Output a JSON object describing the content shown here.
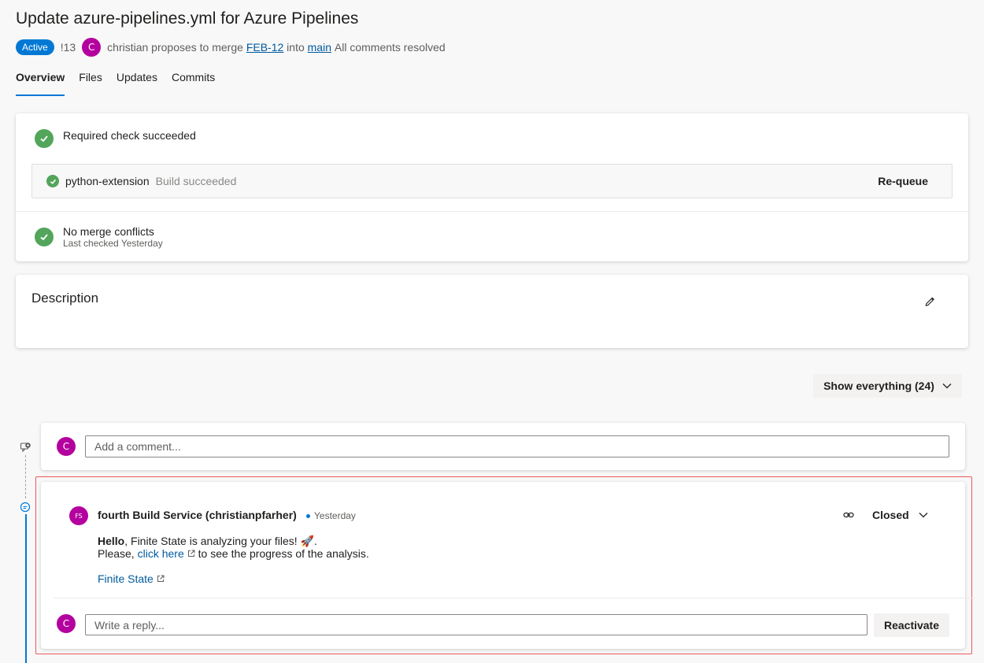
{
  "header": {
    "title": "Update azure-pipelines.yml for Azure Pipelines",
    "status_badge": "Active",
    "pr_id": "!13",
    "author_initial": "C",
    "proposal_text": "christian proposes to merge",
    "source_branch": "FEB-12",
    "into_text": "into",
    "target_branch": "main",
    "comments_status": "All comments resolved"
  },
  "tabs": [
    {
      "label": "Overview",
      "active": true
    },
    {
      "label": "Files",
      "active": false
    },
    {
      "label": "Updates",
      "active": false
    },
    {
      "label": "Commits",
      "active": false
    }
  ],
  "checks": {
    "required_check": "Required check succeeded",
    "build_name": "python-extension",
    "build_status": "Build succeeded",
    "requeue_label": "Re-queue",
    "merge_conflicts": "No merge conflicts",
    "last_checked": "Last checked Yesterday"
  },
  "description": {
    "title": "Description"
  },
  "filter": {
    "show_label": "Show everything (24)"
  },
  "comment_box": {
    "avatar_initial": "C",
    "placeholder": "Add a comment..."
  },
  "thread": {
    "author_initials": "FS",
    "author": "fourth Build Service (christianpfarher)",
    "time": "Yesterday",
    "status": "Closed",
    "msg_bold": "Hello",
    "msg_rest": ", Finite State is analyzing your files! 🚀.",
    "msg_line2_pre": "Please, ",
    "msg_link": "click here",
    "msg_line2_post": " to see the progress of the analysis.",
    "footer_link": "Finite State",
    "reply_avatar_initial": "C",
    "reply_placeholder": "Write a reply...",
    "reactivate_label": "Reactivate"
  },
  "colors": {
    "accent": "#0078d4",
    "success": "#52a55b",
    "avatar": "#b4009e",
    "highlight_border": "#e85a5a"
  }
}
